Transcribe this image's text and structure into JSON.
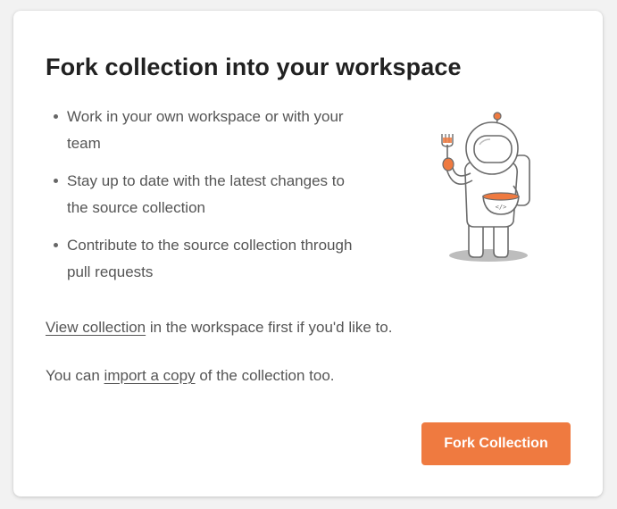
{
  "dialog": {
    "title": "Fork collection into your workspace",
    "bullets": [
      "Work in your own workspace or with your team",
      "Stay up to date with the latest changes to the source collection",
      "Contribute to the source collection through pull requests"
    ],
    "view_link": "View collection",
    "view_suffix": " in the workspace first if you'd like to.",
    "import_prefix": "You can ",
    "import_link": "import a copy",
    "import_suffix": " of the collection too.",
    "fork_button": "Fork Collection",
    "illustration_code_label": "</>",
    "illustration": "astronaut-eating-soup-illustration"
  },
  "colors": {
    "accent": "#ef7a40",
    "text": "#555555",
    "title": "#212121",
    "background": "#ffffff"
  }
}
